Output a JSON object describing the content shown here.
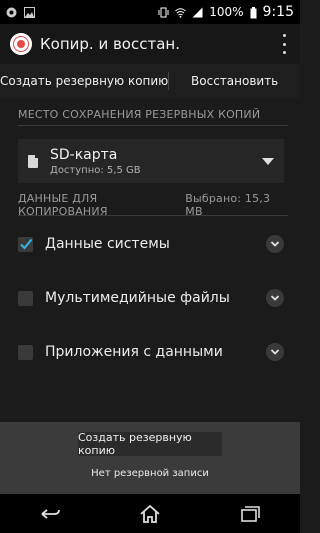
{
  "status_bar": {
    "battery": "100%",
    "time": "9:15",
    "icons": [
      "app-notification-icon",
      "image-notification-icon",
      "vibrate-icon",
      "wifi-icon",
      "signal-icon",
      "battery-icon"
    ]
  },
  "header": {
    "title": "Копир. и восстан."
  },
  "tabs": [
    {
      "label": "Создать резервную копию"
    },
    {
      "label": "Восстановить"
    }
  ],
  "storage_section": {
    "header": "МЕСТО СОХРАНЕНИЯ РЕЗЕРВНЫХ КОПИЙ",
    "selected": {
      "name": "SD-карта",
      "available": "Доступно: 5,5 GB"
    }
  },
  "data_section": {
    "header": "ДАННЫЕ ДЛЯ КОПИРОВАНИЯ",
    "selected_info": "Выбрано: 15,3 MB",
    "items": [
      {
        "label": "Данные системы",
        "checked": true
      },
      {
        "label": "Мультимедийные файлы",
        "checked": false
      },
      {
        "label": "Приложения с данными",
        "checked": false
      }
    ]
  },
  "bottom": {
    "button_label": "Создать резервную копию",
    "status": "Нет резервной записи"
  },
  "colors": {
    "accent": "#33b5e5",
    "background": "#1b1b1b",
    "panel": "#3b3b3b"
  }
}
